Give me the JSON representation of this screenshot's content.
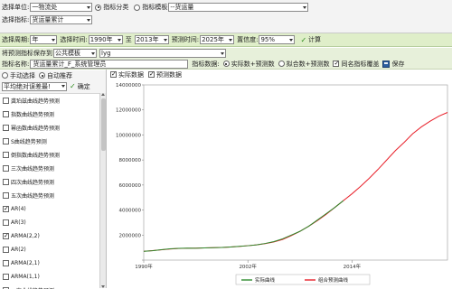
{
  "filters": {
    "unit_label": "选择单位:",
    "unit_value": "一物流处",
    "mode_index_class_label": "指标分类",
    "mode_index_template_label": "指标模板",
    "template_value": "--货运量",
    "index_label": "选择指标:",
    "index_value": "货运量累计",
    "period_label": "选择周期:",
    "period_value": "年",
    "time_label": "选择时间:",
    "time_from": "1990年",
    "to_label": "至",
    "time_to": "2013年",
    "forecast_time_label": "预测时间:",
    "forecast_time": "2025年",
    "confidence_label": "置信度:",
    "confidence_value": "95%",
    "calc_label": "计算"
  },
  "save_bar": {
    "save_to_label": "将预测指标保存到",
    "save_to_value": "公共模板",
    "save_template_value": "lyg",
    "index_name_label": "指标名称:",
    "index_name_value": "货运量累计_F_系统管理员",
    "index_data_label": "指标数据:",
    "opt_actual_forecast": "实际数+预测数",
    "opt_fit_forecast": "拟合数+预测数",
    "overwrite_label": "同名指标覆盖",
    "save_label": "保存"
  },
  "left_panel": {
    "manual_label": "手动选择",
    "auto_label": "自动推荐",
    "criterion_value": "平均绝对误差最!",
    "confirm_label": "确定",
    "methods": [
      {
        "label": "龚珀兹曲线趋势预测",
        "checked": false
      },
      {
        "label": "指数曲线趋势预测",
        "checked": false
      },
      {
        "label": "幂函数曲线趋势预测",
        "checked": false
      },
      {
        "label": "S曲线趋势预测",
        "checked": false
      },
      {
        "label": "倒指数曲线趋势预测",
        "checked": false
      },
      {
        "label": "三次曲线趋势预测",
        "checked": false
      },
      {
        "label": "四次曲线趋势预测",
        "checked": false
      },
      {
        "label": "五次曲线趋势预测",
        "checked": false
      },
      {
        "label": "AR(4)",
        "checked": true
      },
      {
        "label": "AR(3)",
        "checked": false
      },
      {
        "label": "ARMA(2,2)",
        "checked": true
      },
      {
        "label": "AR(2)",
        "checked": false
      },
      {
        "label": "ARMA(2,1)",
        "checked": false
      },
      {
        "label": "ARMA(1,1)",
        "checked": false
      },
      {
        "label": "一次曲线趋势预测",
        "checked": false
      }
    ]
  },
  "chart_toolbar": {
    "actual_label": "实际数据",
    "forecast_label": "预测数据"
  },
  "colors": {
    "actual": "#2e8b2e",
    "forecast": "#e8202a"
  },
  "chart_data": {
    "type": "line",
    "x": [
      1990,
      1991,
      1992,
      1993,
      1994,
      1995,
      1996,
      1997,
      1998,
      1999,
      2000,
      2001,
      2002,
      2003,
      2004,
      2005,
      2006,
      2007,
      2008,
      2009,
      2010,
      2011,
      2012,
      2013,
      2014,
      2015,
      2016,
      2017,
      2018,
      2019,
      2020,
      2021,
      2022,
      2023,
      2024,
      2025
    ],
    "series": [
      {
        "name": "实际曲线",
        "color": "#2e8b2e",
        "values": [
          700000,
          750000,
          830000,
          900000,
          940000,
          960000,
          950000,
          970000,
          990000,
          1010000,
          1050000,
          1100000,
          1150000,
          1220000,
          1330000,
          1480000,
          1700000,
          2000000,
          2300000,
          2700000,
          3200000,
          3700000,
          4200000,
          4750000
        ]
      },
      {
        "name": "组合预测曲线",
        "color": "#e8202a",
        "values": [
          700000,
          760000,
          820000,
          880000,
          930000,
          950000,
          960000,
          975000,
          990000,
          1010000,
          1050000,
          1090000,
          1150000,
          1220000,
          1320000,
          1450000,
          1650000,
          1950000,
          2300000,
          2700000,
          3150000,
          3650000,
          4200000,
          4750000,
          5300000,
          5900000,
          6550000,
          7250000,
          8000000,
          8750000,
          9400000,
          10100000,
          10650000,
          11100000,
          11500000,
          11800000
        ]
      }
    ],
    "y_ticks": [
      "0",
      "2000000",
      "4000000",
      "6000000",
      "8000000",
      "10000000",
      "12000000",
      "14000000"
    ],
    "x_ticks": [
      "1990年",
      "2002年",
      "2014年"
    ],
    "ylim": [
      0,
      14000000
    ],
    "xlim": [
      1990,
      2025
    ]
  }
}
